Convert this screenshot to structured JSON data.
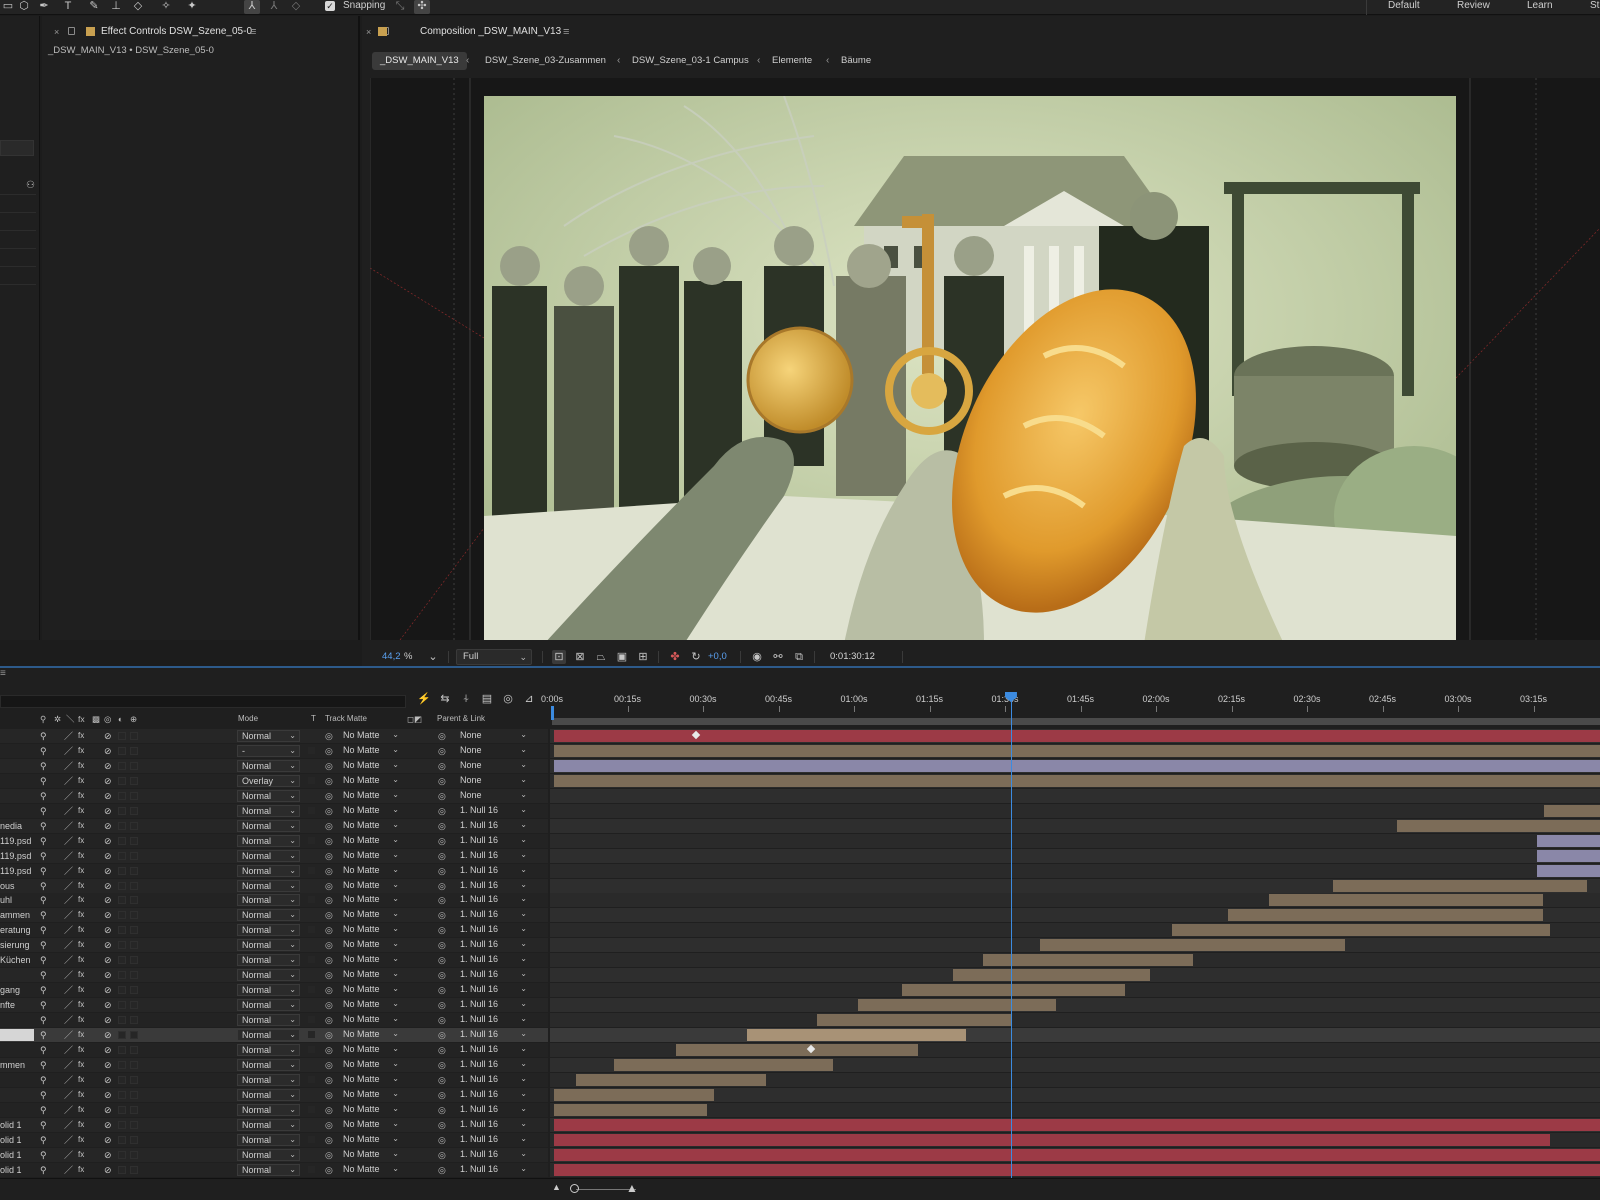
{
  "toolbar": {
    "snapping_label": "Snapping",
    "snapping_checked": true,
    "workspaces": [
      "Default",
      "Review",
      "Learn",
      "St"
    ]
  },
  "effect_controls": {
    "tab_title": "Effect Controls DSW_Szene_05-0",
    "subtitle": "_DSW_MAIN_V13 • DSW_Szene_05-0"
  },
  "composition": {
    "tab_title": "Composition _DSW_MAIN_V13",
    "breadcrumbs": [
      "_DSW_MAIN_V13",
      "DSW_Szene_03-Zusammen",
      "DSW_Szene_03-1 Campus",
      "Elemente",
      "Bäume"
    ],
    "zoom_value": "44,2",
    "zoom_unit": "%",
    "resolution": "Full",
    "exposure": "+0,0",
    "timecode": "0:01:30:12"
  },
  "timeline": {
    "columns": {
      "mode": "Mode",
      "t": "T",
      "track_matte": "Track Matte",
      "parent_link": "Parent & Link"
    },
    "ruler_labels": [
      "0:00s",
      "00:15s",
      "00:30s",
      "00:45s",
      "01:00s",
      "01:15s",
      "01:30s",
      "01:45s",
      "02:00s",
      "02:15s",
      "02:30s",
      "02:45s",
      "03:00s",
      "03:15s"
    ],
    "playhead_fraction": 0.439,
    "layers": [
      {
        "name": "",
        "mode": "Normal",
        "matte": "No Matte",
        "parent": "None",
        "bar": {
          "color": "red",
          "start": 0.004,
          "end": 1.0
        },
        "kf": 0.136
      },
      {
        "name": "",
        "mode": "-",
        "matte": "No Matte",
        "parent": "None",
        "bar": {
          "color": "tan",
          "start": 0.004,
          "end": 1.0
        }
      },
      {
        "name": "",
        "mode": "Normal",
        "matte": "No Matte",
        "parent": "None",
        "bar": {
          "color": "lav",
          "start": 0.004,
          "end": 1.0
        }
      },
      {
        "name": "",
        "mode": "Overlay",
        "matte": "No Matte",
        "parent": "None",
        "bar": {
          "color": "tan",
          "start": 0.004,
          "end": 1.0
        }
      },
      {
        "name": "",
        "mode": "Normal",
        "matte": "No Matte",
        "parent": "None",
        "bar": null
      },
      {
        "name": "",
        "mode": "Normal",
        "matte": "No Matte",
        "parent": "1. Null 16",
        "bar": {
          "color": "tan",
          "start": 0.947,
          "end": 1.0
        }
      },
      {
        "name": "nedia",
        "mode": "Normal",
        "matte": "No Matte",
        "parent": "1. Null 16",
        "bar": {
          "color": "tan",
          "start": 0.807,
          "end": 1.0
        }
      },
      {
        "name": "119.psd",
        "mode": "Normal",
        "matte": "No Matte",
        "parent": "1. Null 16",
        "bar": {
          "color": "lav",
          "start": 0.94,
          "end": 1.0
        }
      },
      {
        "name": "119.psd",
        "mode": "Normal",
        "matte": "No Matte",
        "parent": "1. Null 16",
        "bar": {
          "color": "lav",
          "start": 0.94,
          "end": 1.0
        }
      },
      {
        "name": "119.psd",
        "mode": "Normal",
        "matte": "No Matte",
        "parent": "1. Null 16",
        "bar": {
          "color": "lav",
          "start": 0.94,
          "end": 1.0
        }
      },
      {
        "name": "ous",
        "mode": "Normal",
        "matte": "No Matte",
        "parent": "1. Null 16",
        "bar": {
          "color": "tan",
          "start": 0.746,
          "end": 0.988
        }
      },
      {
        "name": "uhl",
        "mode": "Normal",
        "matte": "No Matte",
        "parent": "1. Null 16",
        "bar": {
          "color": "tan",
          "start": 0.685,
          "end": 0.946
        }
      },
      {
        "name": "ammen",
        "mode": "Normal",
        "matte": "No Matte",
        "parent": "1. Null 16",
        "bar": {
          "color": "tan",
          "start": 0.646,
          "end": 0.946
        }
      },
      {
        "name": "eratung",
        "mode": "Normal",
        "matte": "No Matte",
        "parent": "1. Null 16",
        "bar": {
          "color": "tan",
          "start": 0.592,
          "end": 0.952
        }
      },
      {
        "name": "sierung",
        "mode": "Normal",
        "matte": "No Matte",
        "parent": "1. Null 16",
        "bar": {
          "color": "tan",
          "start": 0.467,
          "end": 0.757
        }
      },
      {
        "name": "Küchen",
        "mode": "Normal",
        "matte": "No Matte",
        "parent": "1. Null 16",
        "bar": {
          "color": "tan",
          "start": 0.412,
          "end": 0.612
        }
      },
      {
        "name": "",
        "mode": "Normal",
        "matte": "No Matte",
        "parent": "1. Null 16",
        "bar": {
          "color": "tan",
          "start": 0.384,
          "end": 0.571
        }
      },
      {
        "name": "gang",
        "mode": "Normal",
        "matte": "No Matte",
        "parent": "1. Null 16",
        "bar": {
          "color": "tan",
          "start": 0.335,
          "end": 0.548
        }
      },
      {
        "name": "nfte",
        "mode": "Normal",
        "matte": "No Matte",
        "parent": "1. Null 16",
        "bar": {
          "color": "tan",
          "start": 0.293,
          "end": 0.482
        }
      },
      {
        "name": "",
        "mode": "Normal",
        "matte": "No Matte",
        "parent": "1. Null 16",
        "bar": {
          "color": "tan",
          "start": 0.254,
          "end": 0.44
        }
      },
      {
        "name": "",
        "mode": "Normal",
        "matte": "No Matte",
        "parent": "1. Null 16",
        "bar": {
          "color": "sel",
          "start": 0.188,
          "end": 0.396
        },
        "selected": true
      },
      {
        "name": "",
        "mode": "Normal",
        "matte": "No Matte",
        "parent": "1. Null 16",
        "bar": {
          "color": "tan",
          "start": 0.12,
          "end": 0.35
        },
        "kf": 0.246
      },
      {
        "name": "mmen",
        "mode": "Normal",
        "matte": "No Matte",
        "parent": "1. Null 16",
        "bar": {
          "color": "tan",
          "start": 0.061,
          "end": 0.27
        }
      },
      {
        "name": "",
        "mode": "Normal",
        "matte": "No Matte",
        "parent": "1. Null 16",
        "bar": {
          "color": "tan",
          "start": 0.025,
          "end": 0.206
        }
      },
      {
        "name": "",
        "mode": "Normal",
        "matte": "No Matte",
        "parent": "1. Null 16",
        "bar": {
          "color": "tan",
          "start": 0.004,
          "end": 0.156
        }
      },
      {
        "name": "",
        "mode": "Normal",
        "matte": "No Matte",
        "parent": "1. Null 16",
        "bar": {
          "color": "tan",
          "start": 0.004,
          "end": 0.15
        }
      },
      {
        "name": "olid 1",
        "mode": "Normal",
        "matte": "No Matte",
        "parent": "1. Null 16",
        "bar": {
          "color": "red",
          "start": 0.004,
          "end": 1.0
        }
      },
      {
        "name": "olid 1",
        "mode": "Normal",
        "matte": "No Matte",
        "parent": "1. Null 16",
        "bar": {
          "color": "red",
          "start": 0.004,
          "end": 0.952
        }
      },
      {
        "name": "olid 1",
        "mode": "Normal",
        "matte": "No Matte",
        "parent": "1. Null 16",
        "bar": {
          "color": "red",
          "start": 0.004,
          "end": 1.0
        }
      },
      {
        "name": "olid 1",
        "mode": "Normal",
        "matte": "No Matte",
        "parent": "1. Null 16",
        "bar": {
          "color": "red",
          "start": 0.004,
          "end": 1.0
        }
      }
    ]
  }
}
